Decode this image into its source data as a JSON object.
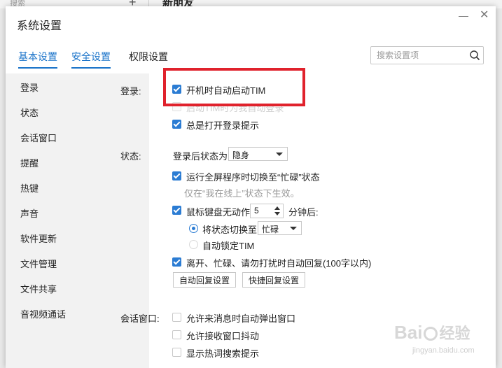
{
  "background": {
    "search_placeholder": "搜索",
    "plus": "+",
    "chat_title": "新朋友"
  },
  "window": {
    "title": "系统设置",
    "minimize_glyph": "—",
    "close_glyph": "✕"
  },
  "tabs": [
    {
      "label": "基本设置",
      "active": true
    },
    {
      "label": "安全设置",
      "active": true
    },
    {
      "label": "权限设置",
      "active": false
    }
  ],
  "search": {
    "placeholder": "搜索设置项",
    "value": ""
  },
  "sidebar": {
    "items": [
      "登录",
      "状态",
      "会话窗口",
      "提醒",
      "热键",
      "声音",
      "软件更新",
      "文件管理",
      "文件共享",
      "音视频通话"
    ]
  },
  "login": {
    "section_label": "登录:",
    "auto_start": {
      "label": "开机时自动启动TIM",
      "checked": true
    },
    "auto_login": {
      "label": "启动TIM时为我自动登录",
      "checked": false,
      "disabled": true
    },
    "show_login_tip": {
      "label": "总是打开登录提示",
      "checked": true
    }
  },
  "status": {
    "section_label": "状态:",
    "after_login_label": "登录后状态为:",
    "after_login_value": "隐身",
    "fullscreen_busy": {
      "label": "运行全屏程序时切换至“忙碌”状态",
      "checked": true
    },
    "fullscreen_note": "仅在“我在线上”状态下生效。",
    "idle": {
      "label": "鼠标键盘无动作",
      "checked": true,
      "minutes": "5",
      "suffix": "分钟后:"
    },
    "idle_switch": {
      "label": "将状态切换至",
      "selected": true,
      "value": "忙碌"
    },
    "idle_lock": {
      "label": "自动锁定TIM",
      "selected": false
    },
    "auto_reply": {
      "label": "离开、忙碌、请勿打扰时自动回复(100字以内)",
      "checked": true
    },
    "auto_reply_button": "自动回复设置",
    "quick_reply_button": "快捷回复设置"
  },
  "session": {
    "section_label": "会话窗口:",
    "popup": {
      "label": "允许来消息时自动弹出窗口",
      "checked": false
    },
    "shake": {
      "label": "允许接收窗口抖动",
      "checked": false
    },
    "hot_words": {
      "label": "显示热词搜索提示",
      "checked": false
    }
  },
  "colors": {
    "accent": "#1a73c9",
    "checkbox": "#2b7cd3",
    "highlight": "#e0222c",
    "sidebar_bg": "#f2f2f2"
  },
  "watermark": {
    "logo_left": "Bai",
    "logo_right": "经验",
    "url": "jingyan.baidu.com"
  }
}
